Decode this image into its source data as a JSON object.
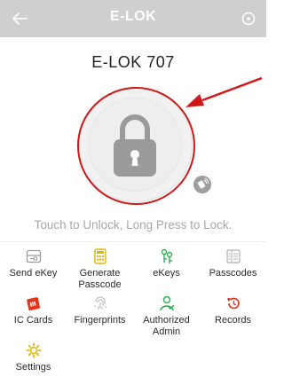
{
  "header": {
    "title": "E-LOK",
    "back_icon": "arrow-left-icon",
    "menu_icon": "target-circle-icon"
  },
  "device": {
    "name": "E-LOK 707"
  },
  "lock": {
    "icon": "padlock-icon",
    "nfc_icon": "nfc-icon"
  },
  "hint": "Touch to Unlock, Long Press to Lock.",
  "features": [
    {
      "label": "Send eKey",
      "icon": "send-ekey-icon",
      "color": "#9a9a9a"
    },
    {
      "label": "Generate\nPasscode",
      "icon": "passcode-keypad-icon",
      "color": "#e2b800"
    },
    {
      "label": "eKeys",
      "icon": "ekeys-icon",
      "color": "#2bb24c"
    },
    {
      "label": "Passcodes",
      "icon": "passcodes-list-icon",
      "color": "#b0b0b0"
    },
    {
      "label": "IC Cards",
      "icon": "ic-card-icon",
      "color": "#e5331a"
    },
    {
      "label": "Fingerprints",
      "icon": "fingerprint-icon",
      "color": "#b8b8b8"
    },
    {
      "label": "Authorized\nAdmin",
      "icon": "admin-user-icon",
      "color": "#2bb24c"
    },
    {
      "label": "Records",
      "icon": "records-history-icon",
      "color": "#e0301c"
    },
    {
      "label": "Settings",
      "icon": "settings-gear-icon",
      "color": "#e2b800"
    }
  ],
  "colors": {
    "topbar": "#cfcfcf",
    "annotation": "#d01818"
  }
}
